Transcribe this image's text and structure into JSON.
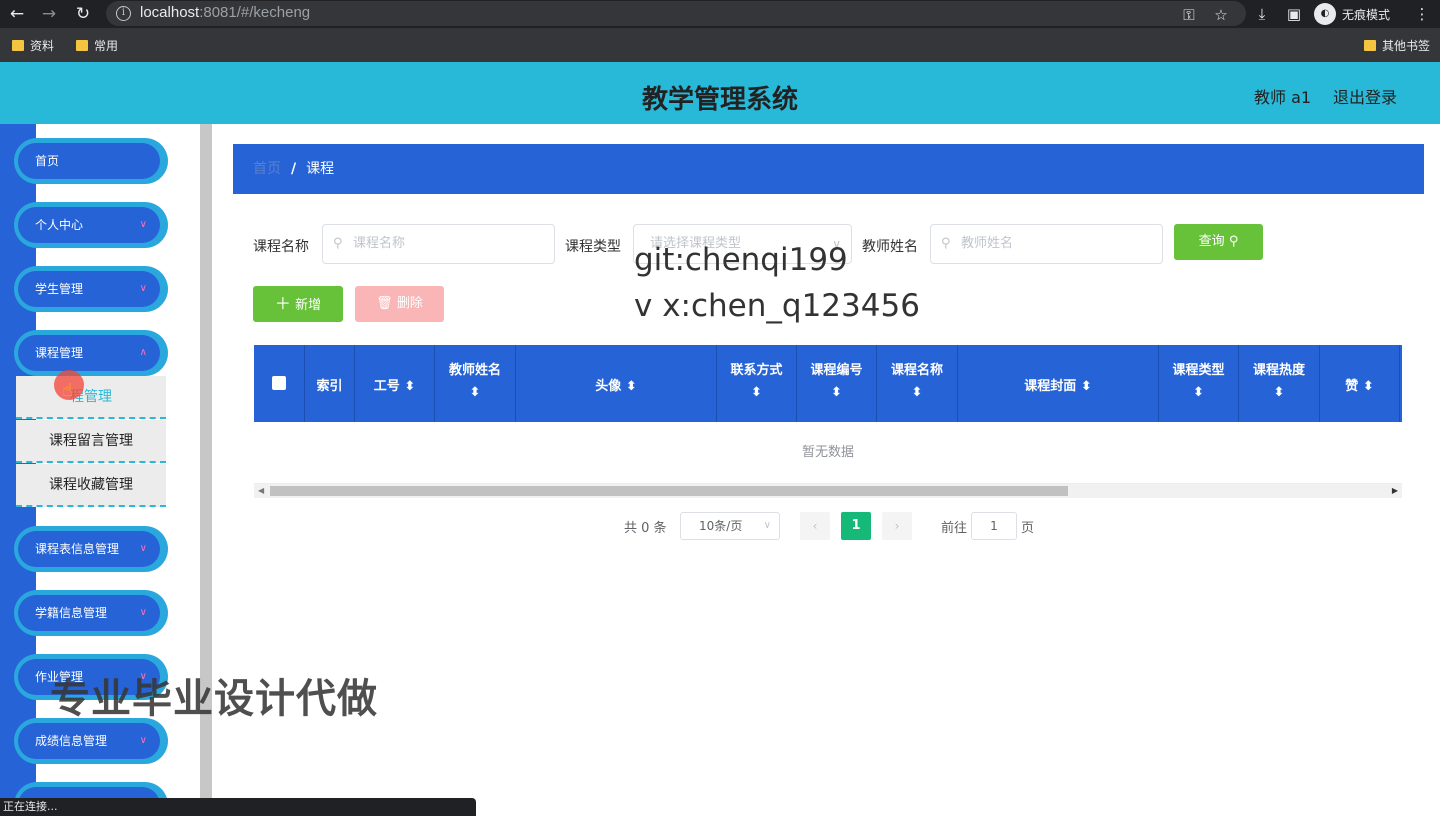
{
  "browser": {
    "url_host": "localhost",
    "url_rest": ":8081/#/kecheng",
    "incognito_label": "无痕模式",
    "bookmarks": [
      "资料",
      "常用"
    ],
    "other_bookmarks": "其他书签",
    "status": "正在连接..."
  },
  "header": {
    "title": "教学管理系统",
    "user": "教师 a1",
    "logout": "退出登录"
  },
  "sidebar": {
    "items": [
      "首页",
      "个人中心",
      "学生管理",
      "课程管理",
      "课程表信息管理",
      "学籍信息管理",
      "作业管理",
      "成绩信息管理"
    ],
    "submenu": [
      "课程管理",
      "课程留言管理",
      "课程收藏管理"
    ],
    "submenu_visible_first": "程管理"
  },
  "breadcrumb": {
    "home": "首页",
    "sep": "/",
    "current": "课程"
  },
  "filters": {
    "course_name_label": "课程名称",
    "course_name_placeholder": "课程名称",
    "course_type_label": "课程类型",
    "course_type_placeholder": "请选择课程类型",
    "teacher_name_label": "教师姓名",
    "teacher_name_placeholder": "教师姓名",
    "query": "查询"
  },
  "actions": {
    "add": "新增",
    "delete": "删除"
  },
  "table": {
    "columns": [
      "索引",
      "工号",
      "教师姓名",
      "头像",
      "联系方式",
      "课程编号",
      "课程名称",
      "课程封面",
      "课程类型",
      "课程热度",
      "赞"
    ],
    "empty_text": "暂无数据"
  },
  "pagination": {
    "total": "共 0 条",
    "page_size": "10条/页",
    "current": "1",
    "goto_label": "前往",
    "goto_value": "1",
    "page_suffix": "页"
  },
  "overlay": {
    "git": "git:chenqi199",
    "wx": "v x:chen_q123456",
    "ad": "专业毕业设计代做"
  },
  "colors": {
    "header": "#29b9d8",
    "primary": "#2563d6",
    "success": "#67c23a",
    "pager": "#17b978"
  }
}
